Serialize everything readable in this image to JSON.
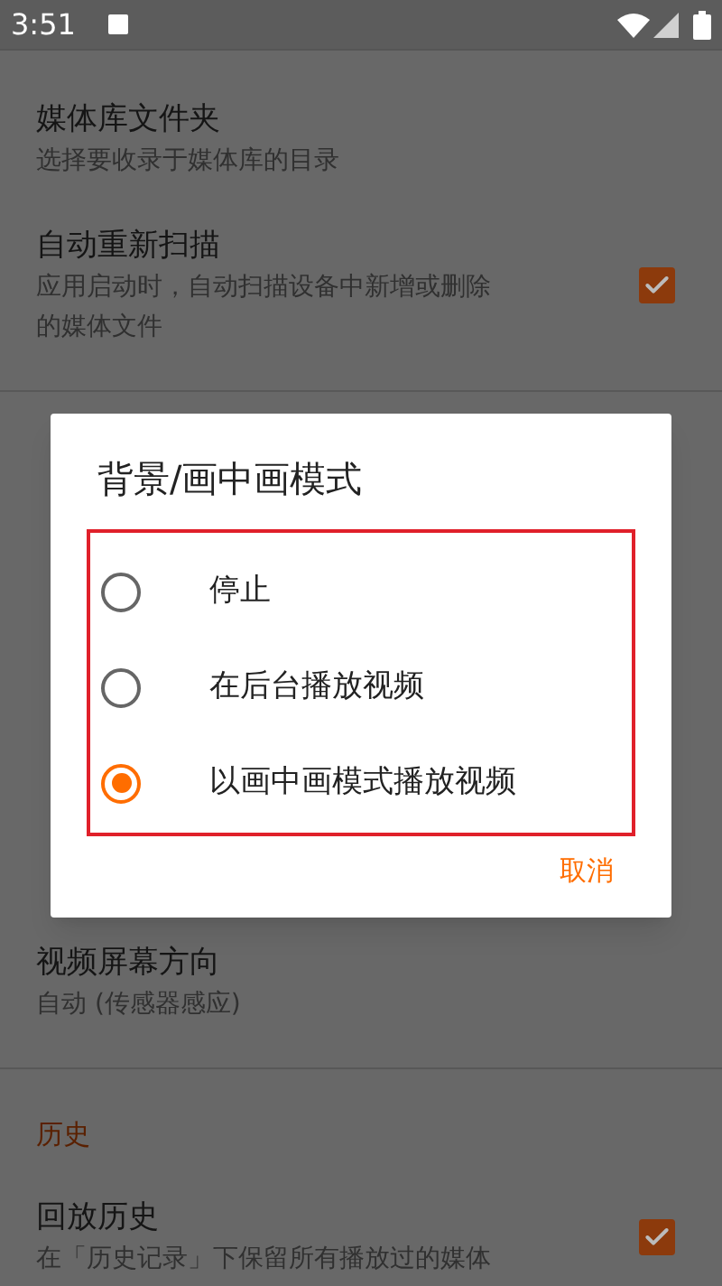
{
  "status_bar": {
    "time": "3:51"
  },
  "settings_top": [
    {
      "kind": "item",
      "title": "媒体库文件夹",
      "subtitle": [
        "选择要收录于媒体库的目录"
      ]
    },
    {
      "kind": "check",
      "title": "自动重新扫描",
      "subtitle": [
        "应用启动时，自动扫描设备中新增或删除",
        "的媒体文件"
      ],
      "checked": true
    },
    {
      "kind": "divider"
    }
  ],
  "settings_bottom": [
    {
      "kind": "item",
      "title": "视频屏幕方向",
      "subtitle": [
        "自动 (传感器感应)"
      ]
    },
    {
      "kind": "divider"
    },
    {
      "kind": "header",
      "title": "历史"
    },
    {
      "kind": "check",
      "title": "回放历史",
      "subtitle": [
        "在「历史记录」下保留所有播放过的媒体"
      ],
      "checked": true
    }
  ],
  "dialog": {
    "title": "背景/画中画模式",
    "options": [
      {
        "label": "停止",
        "selected": false
      },
      {
        "label": "在后台播放视频",
        "selected": false
      },
      {
        "label": "以画中画模式播放视频",
        "selected": true
      }
    ],
    "cancel": "取消"
  }
}
